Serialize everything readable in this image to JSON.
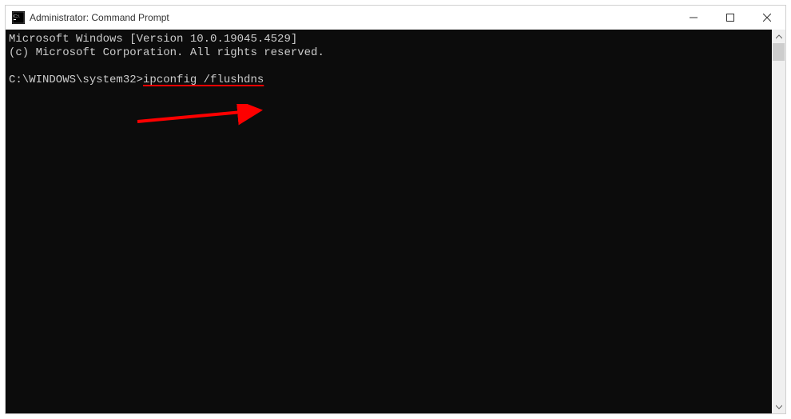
{
  "titlebar": {
    "title": "Administrator: Command Prompt"
  },
  "console": {
    "banner_line1": "Microsoft Windows [Version 10.0.19045.4529]",
    "banner_line2": "(c) Microsoft Corporation. All rights reserved.",
    "prompt": "C:\\WINDOWS\\system32>",
    "command": "ipconfig /flushdns"
  }
}
